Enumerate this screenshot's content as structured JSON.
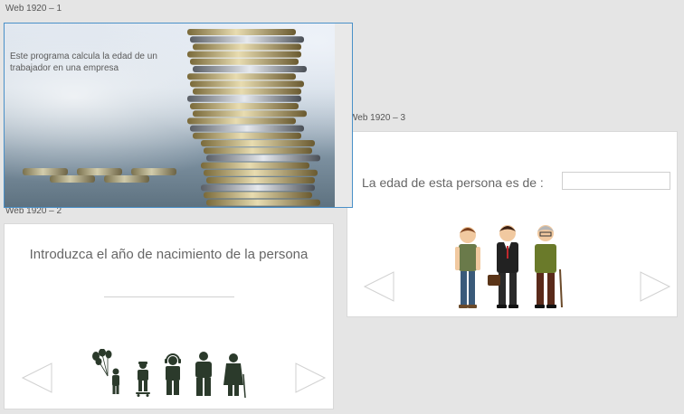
{
  "artboards": {
    "ab1": {
      "label": "Web 1920 – 1",
      "text": "Este programa calcula la edad de un trabajador en una empresa"
    },
    "ab2": {
      "label": "Web 1920 – 2",
      "prompt": "Introduzca el año de nacimiento de la persona"
    },
    "ab3": {
      "label": "Web 1920 – 3",
      "result_label": "La edad de esta persona es de :"
    }
  },
  "icons": {
    "prev": "left-triangle-arrow",
    "next": "right-triangle-arrow",
    "life_stages": [
      "child-with-balloons",
      "boy-with-skateboard",
      "teen-with-headphones",
      "adult-man",
      "elderly-woman-with-cane"
    ],
    "people": [
      "young-man",
      "businessman-with-briefcase",
      "old-man-with-cane"
    ]
  },
  "colors": {
    "canvas": "#e5e5e5",
    "selection": "#4a90c8",
    "arrow_stroke": "#d0d0d0",
    "silhouette": "#2b3a2b"
  }
}
